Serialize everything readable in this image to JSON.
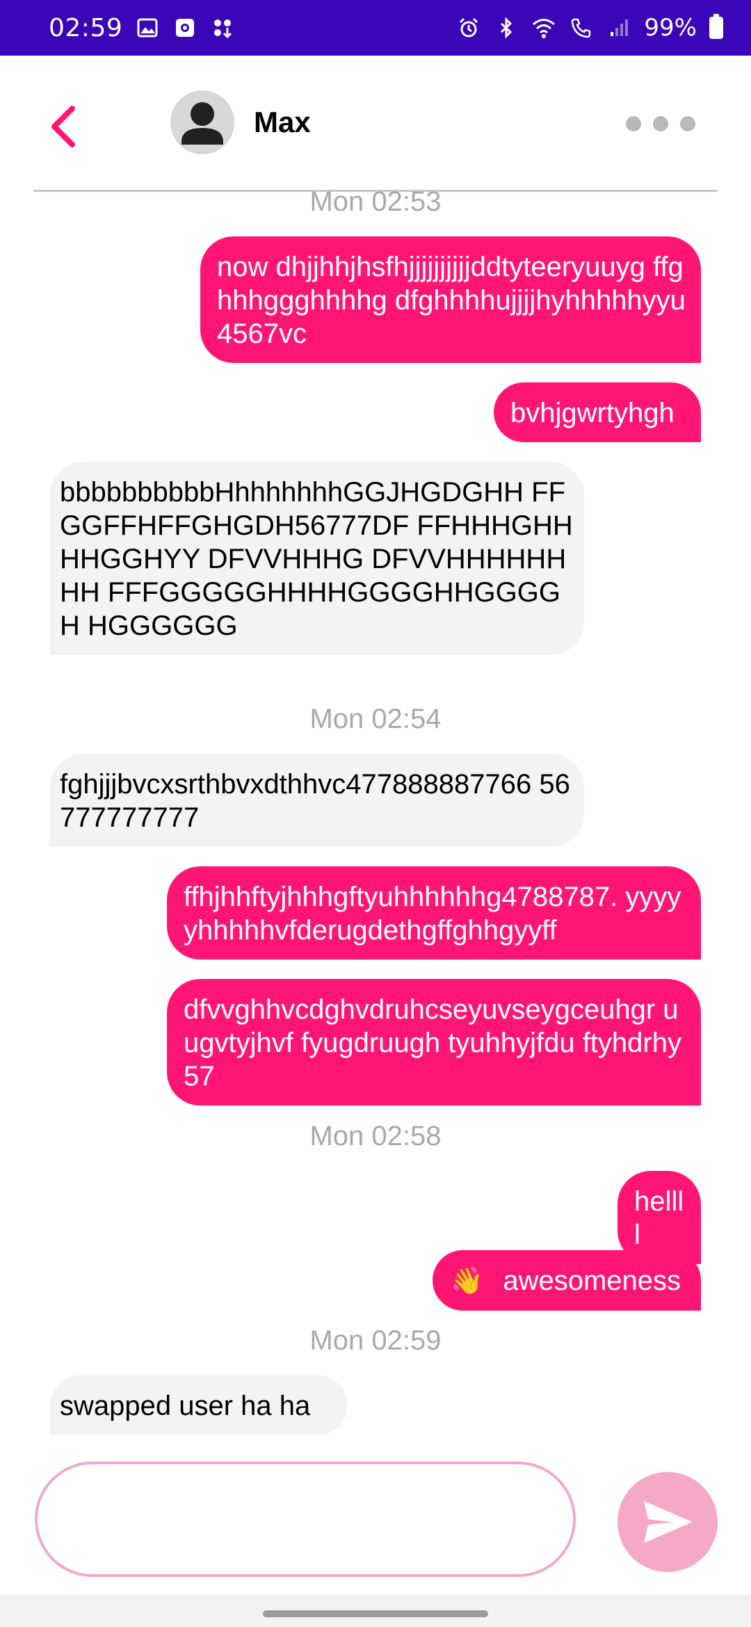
{
  "status_bar": {
    "time": "02:59",
    "battery": "99%",
    "left_icons": [
      "gallery-notification-icon",
      "screen-recorder-icon",
      "app-notification-icon"
    ],
    "right_icons": [
      "alarm-icon",
      "bluetooth-icon",
      "wifi-icon",
      "wifi-calling-icon",
      "signal-icon"
    ]
  },
  "header": {
    "contact_name": "Max",
    "accent_color": "#ff1675"
  },
  "messages": [
    {
      "type": "timestamp",
      "text": "Mon 02:53"
    },
    {
      "type": "out",
      "text": "now dhjjhhjhsfhjjjjjjjjjjddtyteeryuuyg ffghhhggghhhhg dfghhhhujjjjhyhhhhhyyu4567vc"
    },
    {
      "type": "out",
      "text": "bvhjgwrtyhgh"
    },
    {
      "type": "in",
      "text": "bbbbbbbbbbHhhhhhhhGGJHGDGHH FFGGFFHFFGHGDH56777DF FFHHHGHHHHGGHYY DFVVHHHG DFVVHHHHHHHH FFFGGGGGHHHHGGGGHHGGGGH HGGGGGG"
    },
    {
      "type": "timestamp",
      "text": "Mon 02:54"
    },
    {
      "type": "in",
      "text": "fghjjjbvcxsrthbvxdthhvc477888887766 56777777777"
    },
    {
      "type": "out",
      "text": "ffhjhhftyjhhhgftyuhhhhhhg4788787. yyyyyhhhhhvfderugdethgffghhgyyff"
    },
    {
      "type": "out",
      "text": "dfvvghhvcdghvdruhcseyuvseygceuhgr u ugvtyjhvf fyugdruugh tyuhhyjfdu ftyhdrhy57"
    },
    {
      "type": "timestamp",
      "text": "Mon 02:58"
    },
    {
      "type": "out",
      "text": "hellll"
    },
    {
      "type": "out",
      "text": "awesomeness",
      "emoji": "👋"
    },
    {
      "type": "timestamp",
      "text": "Mon 02:59"
    },
    {
      "type": "in",
      "text": "swapped user ha ha"
    }
  ],
  "composer": {
    "placeholder": "",
    "value": ""
  }
}
